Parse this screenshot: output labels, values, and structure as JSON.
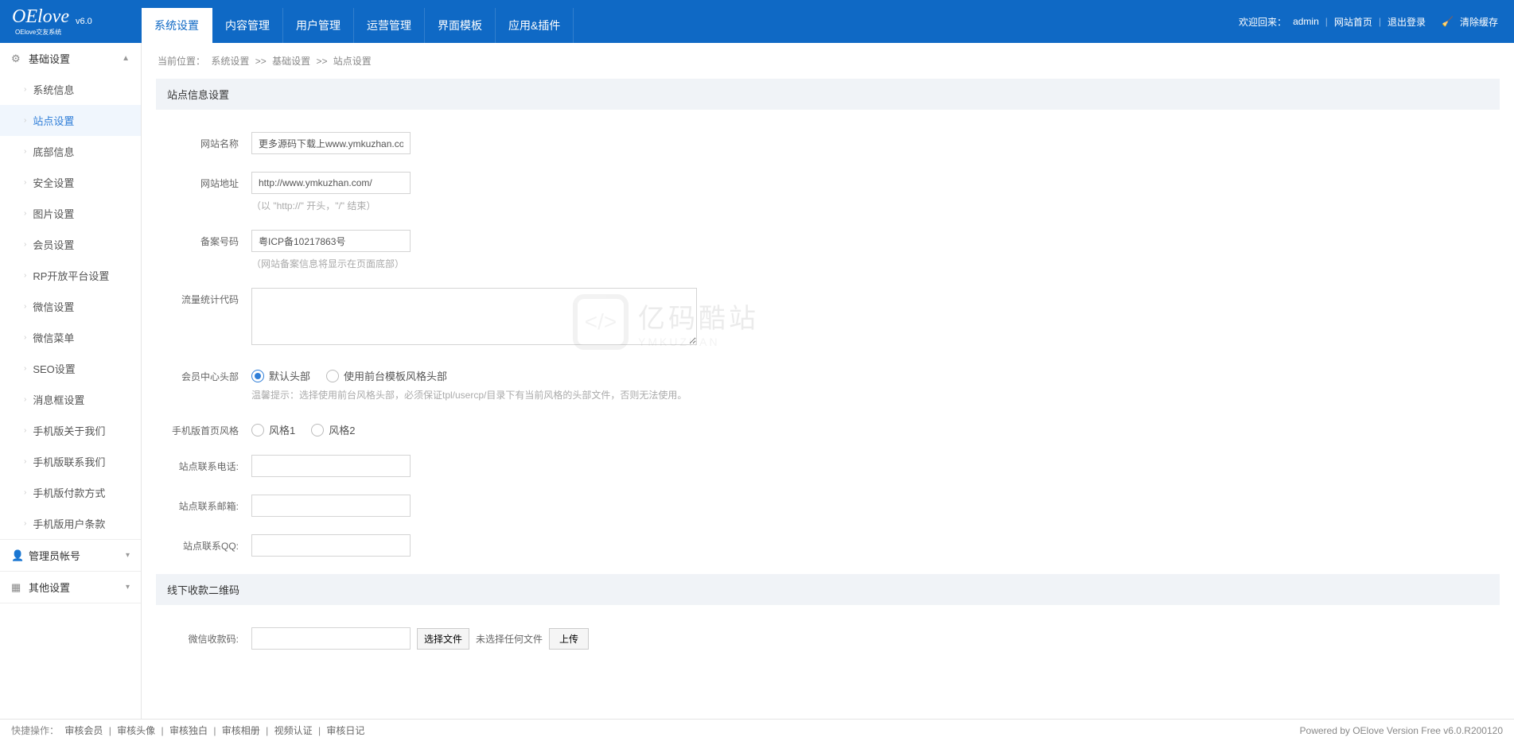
{
  "header": {
    "logo_main": "OElove",
    "logo_sub": "OElove交友系统",
    "version": "v6.0",
    "welcome": "欢迎回来：",
    "admin": "admin",
    "links": [
      "网站首页",
      "退出登录"
    ],
    "clear_cache": "清除缓存"
  },
  "nav": {
    "tabs": [
      "系统设置",
      "内容管理",
      "用户管理",
      "运营管理",
      "界面模板",
      "应用&插件"
    ]
  },
  "sidebar": {
    "groups": [
      {
        "title": "基础设置",
        "icon": "⚙",
        "expanded": true,
        "items": [
          "系统信息",
          "站点设置",
          "底部信息",
          "安全设置",
          "图片设置",
          "会员设置",
          "RP开放平台设置",
          "微信设置",
          "微信菜单",
          "SEO设置",
          "消息框设置",
          "手机版关于我们",
          "手机版联系我们",
          "手机版付款方式",
          "手机版用户条款"
        ],
        "active_index": 1
      },
      {
        "title": "管理员帐号",
        "icon": "👤",
        "expanded": false
      },
      {
        "title": "其他设置",
        "icon": "▦",
        "expanded": false
      }
    ]
  },
  "breadcrumb": {
    "prefix": "当前位置：",
    "items": [
      "系统设置",
      "基础设置",
      "站点设置"
    ],
    "sep": ">>"
  },
  "sections": {
    "site_info": "站点信息设置",
    "qr_code": "线下收款二维码"
  },
  "form": {
    "site_name": {
      "label": "网站名称",
      "value": "更多源码下载上www.ymkuzhan.com"
    },
    "site_url": {
      "label": "网站地址",
      "value": "http://www.ymkuzhan.com/",
      "hint": "（以 \"http://\" 开头，\"/\" 结束）"
    },
    "icp": {
      "label": "备案号码",
      "value": "粤ICP备10217863号",
      "hint": "（网站备案信息将显示在页面底部）"
    },
    "stats": {
      "label": "流量统计代码",
      "value": ""
    },
    "member_head": {
      "label": "会员中心头部",
      "options": [
        "默认头部",
        "使用前台模板风格头部"
      ],
      "selected": 0,
      "hint": "温馨提示：选择使用前台风格头部，必须保证tpl/usercp/目录下有当前风格的头部文件，否则无法使用。"
    },
    "mobile_style": {
      "label": "手机版首页风格",
      "options": [
        "风格1",
        "风格2"
      ],
      "selected": -1
    },
    "contact_phone": {
      "label": "站点联系电话:",
      "value": ""
    },
    "contact_email": {
      "label": "站点联系邮箱:",
      "value": ""
    },
    "contact_qq": {
      "label": "站点联系QQ:",
      "value": ""
    },
    "wechat_pay": {
      "label": "微信收款码:",
      "value": "",
      "file_btn": "选择文件",
      "file_text": "未选择任何文件",
      "upload_btn": "上传"
    }
  },
  "watermark": {
    "cn": "亿码酷站",
    "en": "YMKUZHAN"
  },
  "footer": {
    "prefix": "快捷操作：",
    "links": [
      "审核会员",
      "审核头像",
      "审核独白",
      "审核相册",
      "视频认证",
      "审核日记"
    ],
    "right": "Powered by OElove Version Free v6.0.R200120"
  }
}
